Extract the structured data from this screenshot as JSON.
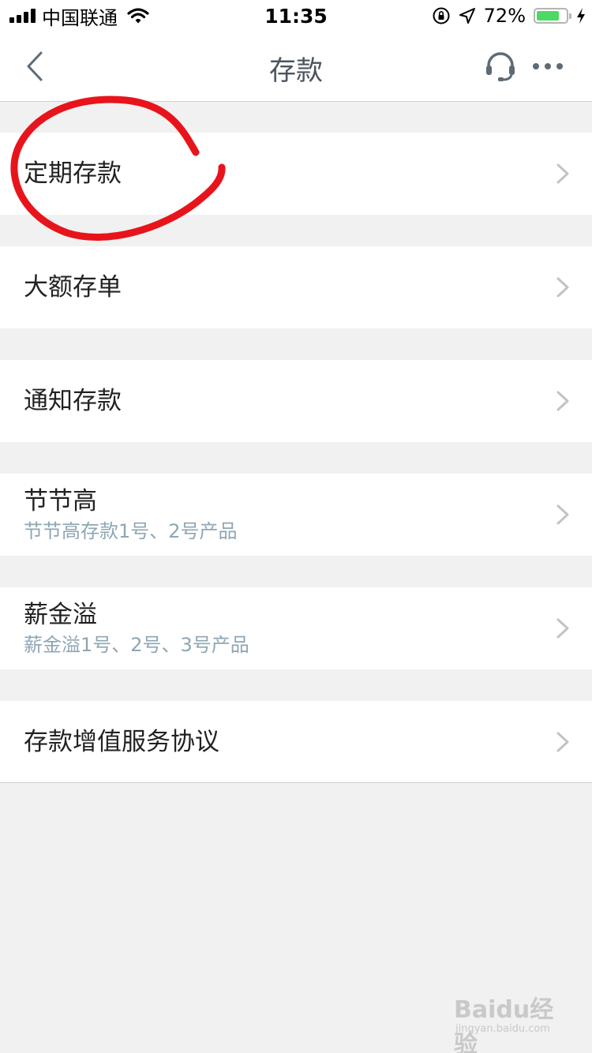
{
  "status_bar": {
    "carrier": "中国联通",
    "time": "11:35",
    "battery_percent": "72%",
    "battery_color": "#4cd964"
  },
  "nav": {
    "title": "存款",
    "back_icon": "chevron-left-icon",
    "service_icon": "headset-icon",
    "more_icon": "more-dots-icon"
  },
  "items": [
    {
      "title": "定期存款",
      "subtitle": ""
    },
    {
      "title": "大额存单",
      "subtitle": ""
    },
    {
      "title": "通知存款",
      "subtitle": ""
    },
    {
      "title": "节节高",
      "subtitle": "节节高存款1号、2号产品"
    },
    {
      "title": "薪金溢",
      "subtitle": "薪金溢1号、2号、3号产品"
    },
    {
      "title": "存款增值服务协议",
      "subtitle": ""
    }
  ],
  "annotation_color": "#e8141b",
  "watermark": {
    "text": "Baidu经验",
    "url": "jingyan.baidu.com"
  }
}
